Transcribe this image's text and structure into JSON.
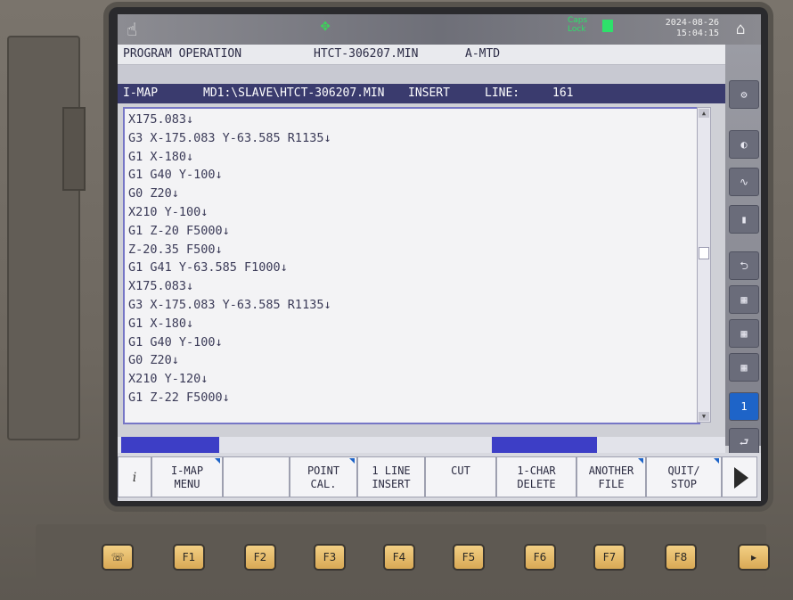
{
  "status": {
    "caps_lock": "Caps\nLock",
    "date": "2024-08-26",
    "time": "15:04:15"
  },
  "program_bar": {
    "mode": "PROGRAM OPERATION",
    "program": "HTCT-306207.MIN",
    "machine": "A-MTD"
  },
  "edit_bar": {
    "view": "I-MAP",
    "path": "MD1:\\SLAVE\\HTCT-306207.MIN",
    "mode": "INSERT",
    "line_label": "LINE:",
    "line_number": "161"
  },
  "code_lines": [
    "X175.083↓",
    "G3 X-175.083 Y-63.585 R1135↓",
    "G1 X-180↓",
    "G1 G40 Y-100↓",
    "G0 Z20↓",
    "X210 Y-100↓",
    "G1 Z-20 F5000↓",
    "Z-20.35 F500↓",
    "G1 G41 Y-63.585 F1000↓",
    "X175.083↓",
    "G3 X-175.083 Y-63.585 R1135↓",
    "G1 X-180↓",
    "G1 G40 Y-100↓",
    "G0 Z20↓",
    "X210 Y-120↓",
    "G1 Z-22 F5000↓"
  ],
  "softkeys": {
    "imap_menu": "I-MAP\nMENU",
    "point_cal": "POINT\nCAL.",
    "line_insert": "1 LINE\nINSERT",
    "cut": "CUT",
    "char_delete": "1-CHAR\nDELETE",
    "another_file": "ANOTHER\nFILE",
    "quit_stop": "QUIT/\nSTOP"
  },
  "side_buttons": {
    "page_indicator": "1"
  },
  "function_keys": [
    "F1",
    "F2",
    "F3",
    "F4",
    "F5",
    "F6",
    "F7",
    "F8"
  ]
}
